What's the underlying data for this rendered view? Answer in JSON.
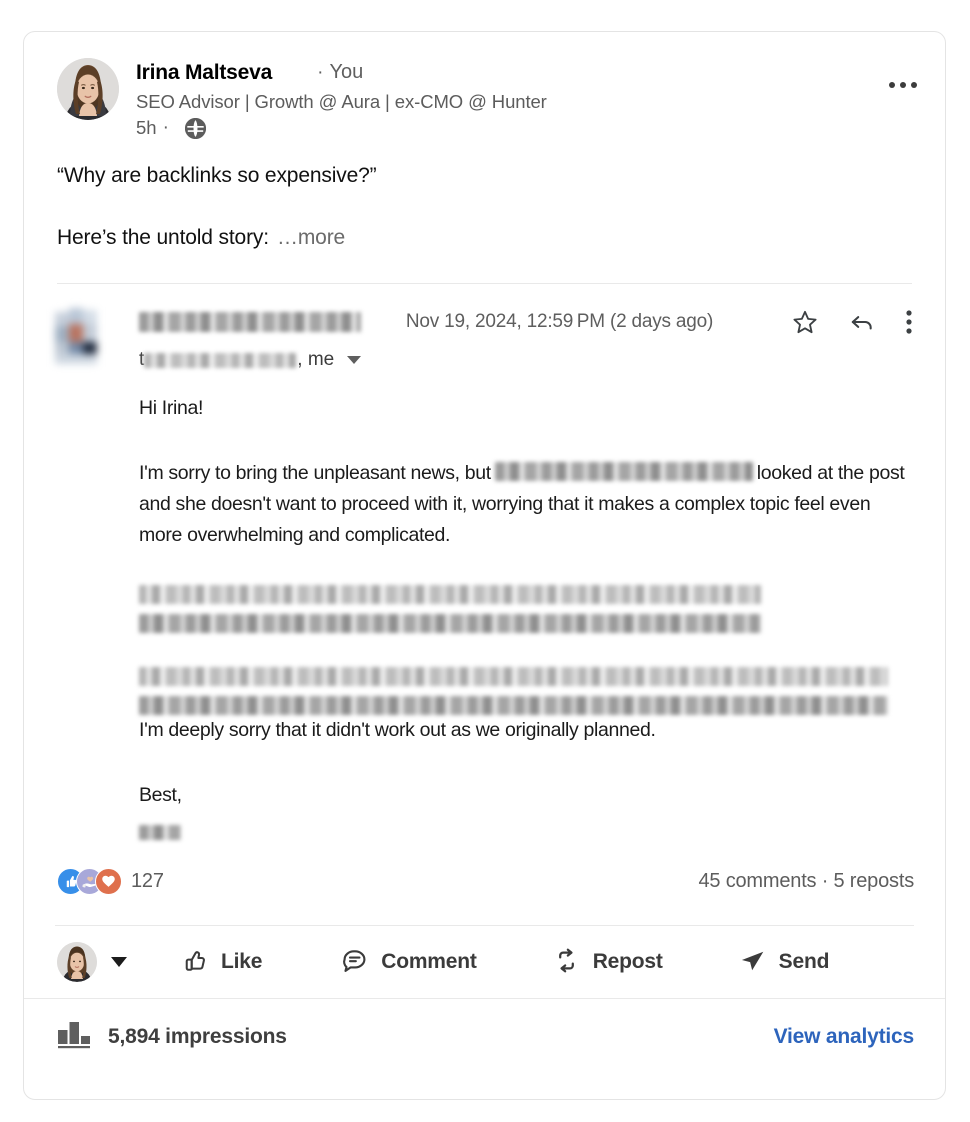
{
  "post": {
    "author": {
      "name": "Irina Maltseva",
      "flag_icon": "ukraine-flag-icon",
      "relationship": "You",
      "separator": "·",
      "headline": "SEO Advisor | Growth @ Aura | ex-CMO @ Hunter",
      "time_ago": "5h",
      "visibility_icon": "globe-icon"
    },
    "overflow_menu_icon": "ellipsis-icon",
    "text": {
      "line1": "“Why are backlinks so expensive?”",
      "line2": "Here’s the untold story:",
      "more_label": "…more"
    },
    "embed": {
      "type": "email-screenshot",
      "sender_name": "[redacted]",
      "recipient_prefix": "t",
      "recipient_name": "[redacted]",
      "recipient_me": ", me",
      "date": "Nov 19, 2024, 12:59 PM (2 days ago)",
      "actions": [
        {
          "name": "star-icon",
          "label": "Star"
        },
        {
          "name": "reply-icon",
          "label": "Reply"
        },
        {
          "name": "more-vertical-icon",
          "label": "More"
        }
      ],
      "body": {
        "greeting": "Hi Irina!",
        "paragraph1_before": "I'm sorry to bring the unpleasant news, but",
        "paragraph1_redacted": "[redacted]",
        "paragraph1_after": "looked at the post and she doesn't want to proceed with it, worrying that it makes a complex topic feel even more overwhelming and complicated.",
        "paragraph2_redacted": "[redacted]",
        "paragraph3_redacted": "[redacted]",
        "paragraph4": "I'm deeply sorry that it didn't work out as we originally planned.",
        "signoff": "Best,",
        "signature_redacted": "[redacted]"
      }
    },
    "social": {
      "reactions": [
        {
          "name": "like-reaction-icon",
          "label": "Like",
          "color": "#378fe9"
        },
        {
          "name": "support-reaction-icon",
          "label": "Support",
          "color": "#a8a8d9"
        },
        {
          "name": "love-reaction-icon",
          "label": "Love",
          "color": "#df704d"
        }
      ],
      "reaction_count": "127",
      "comments_reposts": "45 comments · 5 reposts"
    },
    "actions": [
      {
        "icon": "thumbs-up-icon",
        "label": "Like"
      },
      {
        "icon": "comment-icon",
        "label": "Comment"
      },
      {
        "icon": "repost-icon",
        "label": "Repost"
      },
      {
        "icon": "send-icon",
        "label": "Send"
      }
    ],
    "analytics": {
      "chart_icon": "bar-chart-icon",
      "impressions": "5,894 impressions",
      "view_link": "View analytics",
      "link_color": "#2d64bc"
    }
  }
}
